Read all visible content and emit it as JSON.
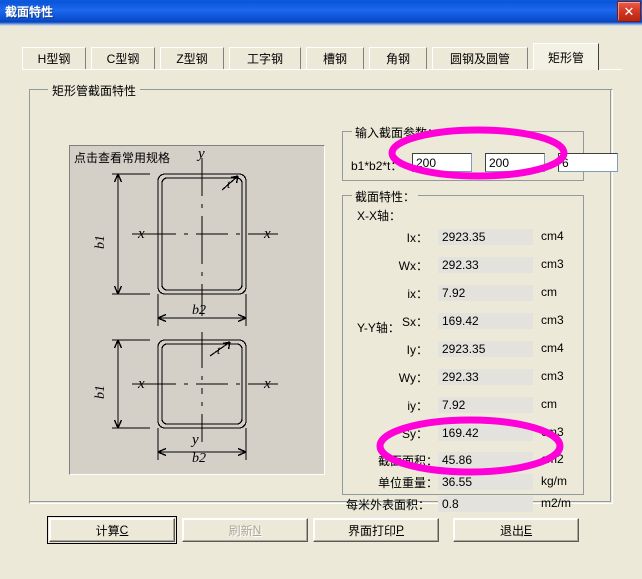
{
  "window": {
    "title": "截面特性",
    "close_label": "✕"
  },
  "tabs": [
    {
      "label": "H型钢",
      "selected": false
    },
    {
      "label": "C型钢",
      "selected": false
    },
    {
      "label": "Z型钢",
      "selected": false
    },
    {
      "label": "工字钢",
      "selected": false
    },
    {
      "label": "槽钢",
      "selected": false
    },
    {
      "label": "角钢",
      "selected": false
    },
    {
      "label": "圆钢及圆管",
      "selected": false
    },
    {
      "label": "矩形管",
      "selected": true
    }
  ],
  "group": {
    "title": "矩形管截面特性"
  },
  "diagram": {
    "hint_link": "点击查看常用规格",
    "labels": {
      "y_axis": "y",
      "x_axis": "x",
      "b1": "b1",
      "b2": "b2",
      "t": "t"
    }
  },
  "input_group": {
    "legend": "输入截面参数：",
    "param_label": "b1*b2*t：",
    "fields": [
      {
        "name": "b1",
        "value": "200"
      },
      {
        "name": "b2",
        "value": "200"
      },
      {
        "name": "t",
        "value": "6"
      }
    ]
  },
  "results_group": {
    "legend": "截面特性：",
    "axis_x_label": "X-X轴：",
    "axis_y_label": "Y-Y轴：",
    "x_rows": [
      {
        "label": "Ix：",
        "value": "2923.35",
        "unit": "cm4"
      },
      {
        "label": "Wx：",
        "value": "292.33",
        "unit": "cm3"
      },
      {
        "label": "ix：",
        "value": "7.92",
        "unit": "cm"
      },
      {
        "label": "Sx：",
        "value": "169.42",
        "unit": "cm3"
      }
    ],
    "y_rows": [
      {
        "label": "Iy：",
        "value": "2923.35",
        "unit": "cm4"
      },
      {
        "label": "Wy：",
        "value": "292.33",
        "unit": "cm3"
      },
      {
        "label": "iy：",
        "value": "7.92",
        "unit": "cm"
      },
      {
        "label": "Sy：",
        "value": "169.42",
        "unit": "cm3"
      }
    ],
    "summary_rows": [
      {
        "label": "截面面积：",
        "value": "45.86",
        "unit": "cm2"
      },
      {
        "label": "单位重量：",
        "value": "36.55",
        "unit": "kg/m"
      },
      {
        "label": "每米外表面积：",
        "value": "0.8",
        "unit": "m2/m"
      }
    ]
  },
  "buttons": [
    {
      "label": "计算",
      "accel": "C",
      "state": "default"
    },
    {
      "label": "刷新",
      "accel": "N",
      "state": "disabled"
    },
    {
      "label": "界面打印",
      "accel": "P",
      "state": "normal"
    },
    {
      "label": "退出",
      "accel": "E",
      "state": "normal"
    }
  ],
  "annotations": {
    "color": "#ff00d8",
    "ellipses": [
      "input-fields-highlight",
      "unit-weight-highlight"
    ]
  }
}
